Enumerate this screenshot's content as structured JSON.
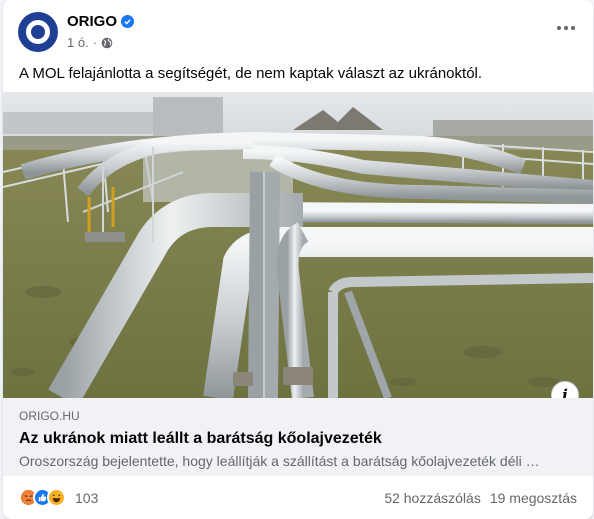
{
  "post": {
    "author": "ORIGO",
    "time": "1 ó.",
    "separator": "·",
    "text": "A MOL felajánlotta a segítségét, de nem kaptak választ az ukránoktól."
  },
  "link": {
    "domain": "ORIGO.HU",
    "title": "Az ukránok miatt leállt a barátság kőolajvezeték",
    "description": "Oroszország bejelentette, hogy leállítják a szállítást a barátság kőolajvezeték déli …"
  },
  "info_glyph": "i",
  "footer": {
    "reaction_count": "103",
    "comments": "52 hozzászólás",
    "shares": "19 megosztás"
  },
  "icons": {
    "avatar": "origo-logo-icon",
    "verified": "verified-badge-icon",
    "privacy": "globe-icon",
    "more": "more-options-icon",
    "reactions": [
      "angry-icon",
      "like-icon",
      "haha-icon"
    ]
  },
  "colors": {
    "brand": "#1e3f93",
    "verified": "#1877f2",
    "link_bg": "#f0f2f5",
    "muted_text": "#65676b"
  }
}
